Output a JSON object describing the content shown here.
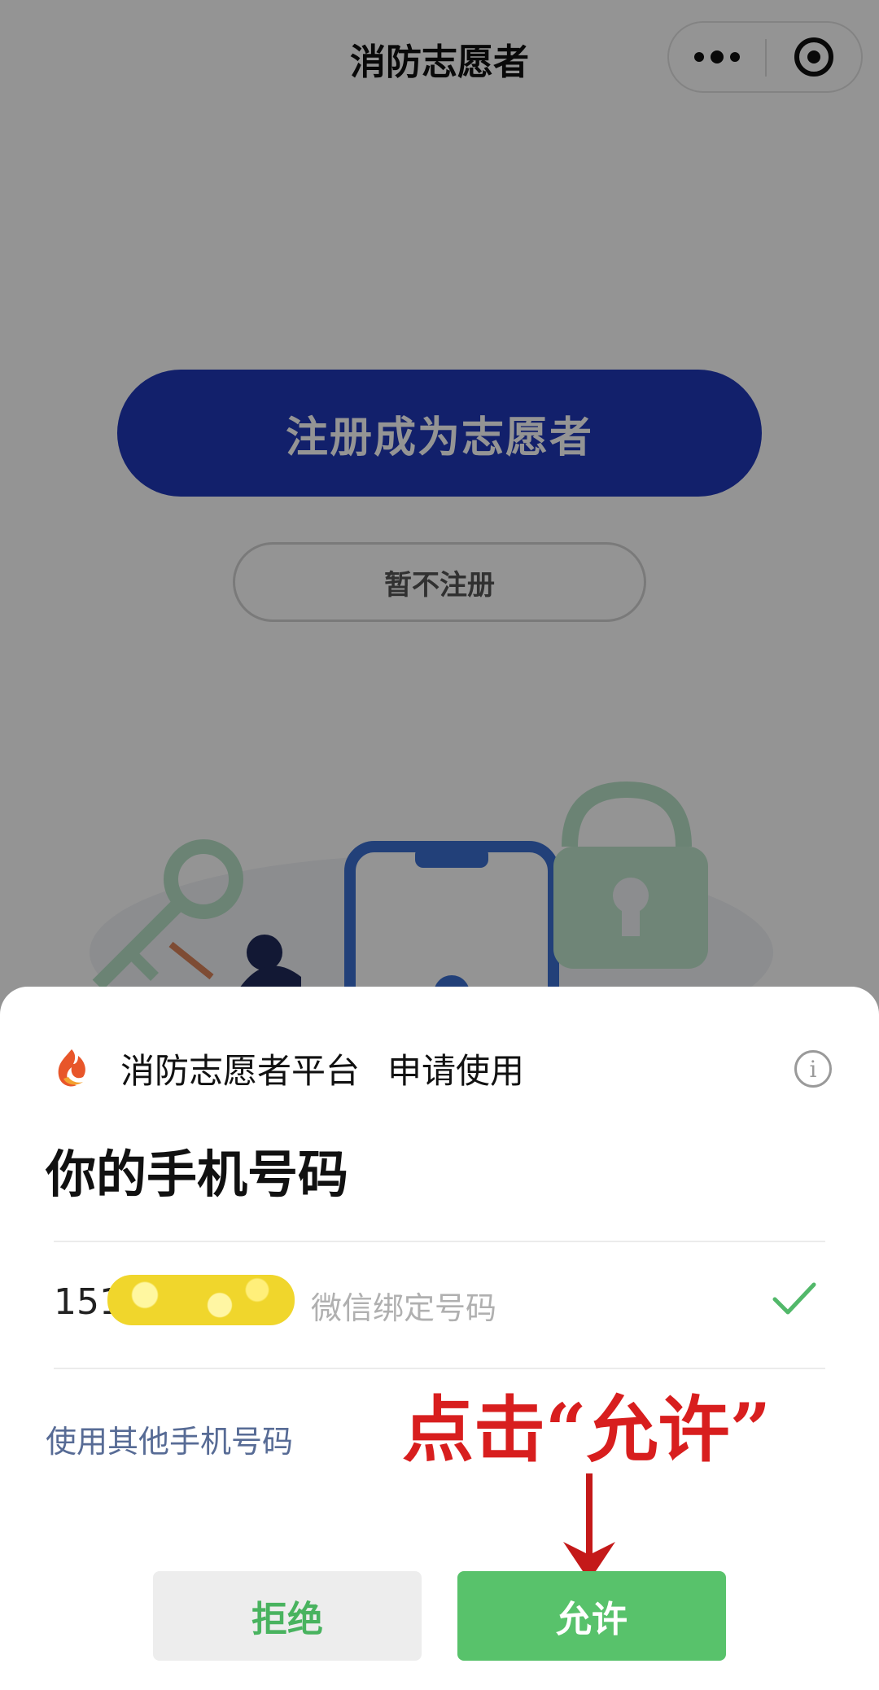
{
  "nav": {
    "title": "消防志愿者",
    "more_icon": "more-dots-icon",
    "close_icon": "target-circle-icon"
  },
  "main": {
    "register_label": "注册成为志愿者",
    "skip_label": "暂不注册",
    "primary_color": "#2037b8"
  },
  "dialog": {
    "app_name": "消防志愿者平台",
    "action": "申请使用",
    "title": "你的手机号码",
    "phone_prefix": "151",
    "phone_tag": "微信绑定号码",
    "other_phone_link": "使用其他手机号码",
    "deny_label": "拒绝",
    "allow_label": "允许",
    "allow_color": "#58c26b"
  },
  "annotation": {
    "text": "点击“允许”",
    "color": "#d81e1e"
  }
}
